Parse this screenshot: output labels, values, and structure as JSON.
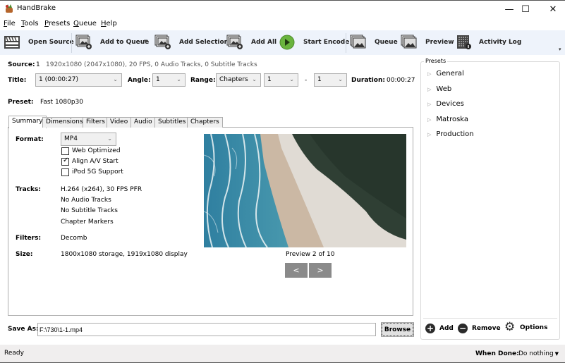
{
  "window": {
    "title": "HandBrake",
    "controls": {
      "minimize": "—",
      "maximize": "☐",
      "close": "✕"
    }
  },
  "menu": [
    {
      "label": "File",
      "accel": "F",
      "rest": "ile"
    },
    {
      "label": "Tools",
      "accel": "T",
      "rest": "ools"
    },
    {
      "label": "Presets",
      "accel": "P",
      "rest": "resets"
    },
    {
      "label": "Queue",
      "accel": "Q",
      "rest": "ueue"
    },
    {
      "label": "Help",
      "accel": "H",
      "rest": "elp"
    }
  ],
  "toolbar": {
    "open_source": "Open Source",
    "add_to_queue": "Add to Queue",
    "add_selection": "Add Selection",
    "add_all": "Add All",
    "start_encode": "Start Encode",
    "queue": "Queue",
    "preview": "Preview",
    "activity_log": "Activity Log",
    "overflow": "▾"
  },
  "source": {
    "label": "Source:",
    "number": "1",
    "info": "1920x1080 (2047x1080), 20 FPS, 0 Audio Tracks, 0 Subtitle Tracks"
  },
  "title_row": {
    "title_label": "Title:",
    "title_value": "1 (00:00:27)",
    "angle_label": "Angle:",
    "angle_value": "1",
    "range_label": "Range:",
    "range_value": "Chapters",
    "range_start": "1",
    "range_sep": "-",
    "range_end": "1",
    "duration_label": "Duration:",
    "duration_value": "00:00:27"
  },
  "preset": {
    "label": "Preset:",
    "value": "Fast 1080p30"
  },
  "tabs": [
    "Summary",
    "Dimensions",
    "Filters",
    "Video",
    "Audio",
    "Subtitles",
    "Chapters"
  ],
  "summary": {
    "format_label": "Format:",
    "format_value": "MP4",
    "options": [
      {
        "label": "Web Optimized",
        "checked": false
      },
      {
        "label": "Align A/V Start",
        "checked": true
      },
      {
        "label": "iPod 5G Support",
        "checked": false
      }
    ],
    "tracks_label": "Tracks:",
    "tracks": [
      "H.264 (x264), 30 FPS PFR",
      "No Audio Tracks",
      "No Subtitle Tracks",
      "Chapter Markers"
    ],
    "filters_label": "Filters:",
    "filters_value": "Decomb",
    "size_label": "Size:",
    "size_value": "1800x1080 storage, 1919x1080 display"
  },
  "preview": {
    "caption": "Preview 2 of 10",
    "current": 2,
    "total": 10,
    "prev": "<",
    "next": ">"
  },
  "presets_panel": {
    "legend": "Presets",
    "items": [
      "General",
      "Web",
      "Devices",
      "Matroska",
      "Production"
    ],
    "add": "Add",
    "remove": "Remove",
    "options": "Options"
  },
  "save_as": {
    "label": "Save As:",
    "value": "F:\\730\\1-1.mp4",
    "browse": "Browse"
  },
  "status": {
    "text": "Ready",
    "when_done_label": "When Done:",
    "when_done_value": "Do nothing"
  },
  "colors": {
    "toolbar_bg": "#eef3fb",
    "start_green": "#6ab43e",
    "statusbar_bg": "#f0eeee"
  }
}
